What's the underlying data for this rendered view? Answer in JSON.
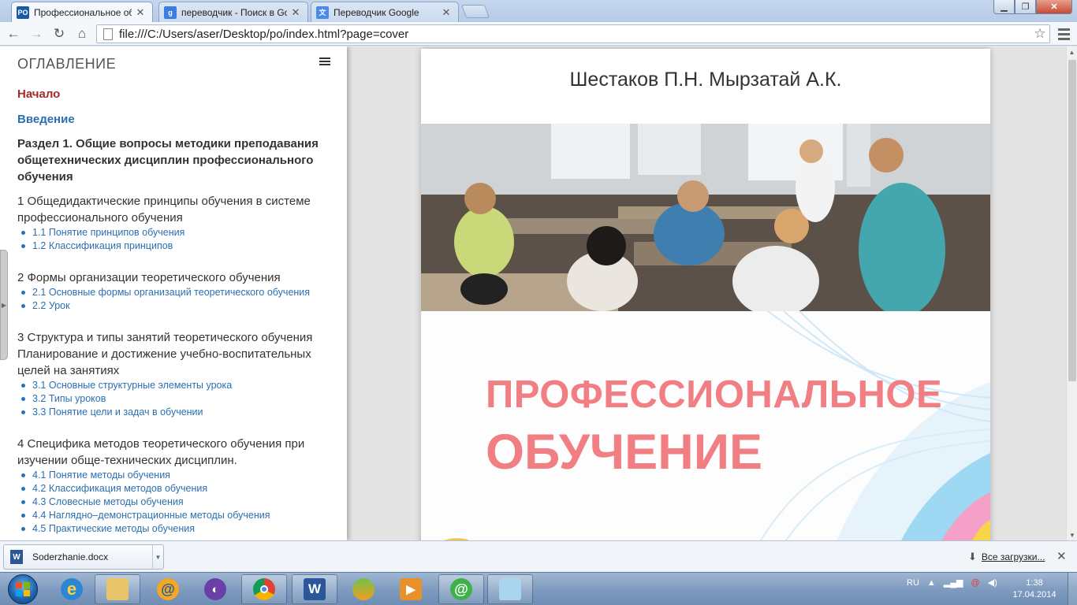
{
  "tabs": [
    {
      "title": "Профессиональное обуч",
      "favicon": "PO",
      "favicon_color": "#1a5aa6",
      "active": true
    },
    {
      "title": "переводчик - Поиск в Goo",
      "favicon": "g",
      "favicon_color": "#3b7de0",
      "active": false
    },
    {
      "title": "Переводчик Google",
      "favicon": "文",
      "favicon_color": "#4a8ae8",
      "active": false
    }
  ],
  "toolbar": {
    "url": "file:///C:/Users/aser/Desktop/po/index.html?page=cover",
    "back_icon": "arrow-left-icon",
    "forward_icon": "arrow-right-icon",
    "reload_icon": "reload-icon",
    "home_icon": "home-icon",
    "bookmark_icon": "star-icon",
    "menu_icon": "menu-icon"
  },
  "sidebar": {
    "title": "ОГЛАВЛЕНИЕ",
    "start": "Начало",
    "intro": "Введение",
    "section": "Раздел 1. Общие вопросы методики преподавания общетехнических дисциплин профессионального обучения",
    "chapters": [
      {
        "title": "1 Общедидактические принципы обучения в системе профессионального обучения",
        "items": [
          "1.1 Понятие принципов обучения",
          "1.2 Классификация принципов"
        ]
      },
      {
        "title": "2 Формы организации теоретического обучения",
        "items": [
          "2.1 Основные формы организаций теоретического обучения",
          "2.2 Урок"
        ]
      },
      {
        "title": "3 Структура и типы занятий теоретического обучения Планирование и достижение учебно-воспитательных целей на занятиях",
        "items": [
          "3.1 Основные структурные элементы урока",
          "3.2 Типы уроков",
          "3.3 Понятие цели и задач в обучении"
        ]
      },
      {
        "title": "4 Специфика методов теоретического обучения при изучении обще-технических дисциплин.",
        "items": [
          "4.1 Понятие методы обучения",
          "4.2 Классификация методов обучения",
          "4.3 Словесные методы обучения",
          "4.4 Наглядно–демонстрационные методы обучения",
          "4.5 Практические методы обучения"
        ]
      }
    ]
  },
  "cover": {
    "authors": "Шестаков П.Н. Мырзатай А.К.",
    "title_line1": "ПРОФЕССИОНАЛЬНОЕ",
    "title_line2": "ОБУЧЕНИЕ",
    "title_color": "#f07e82"
  },
  "downloads": {
    "file_name": "Soderzhanie.docx",
    "all_label": "Все загрузки..."
  },
  "taskbar": {
    "language": "RU",
    "time": "1:38",
    "date": "17.04.2014",
    "apps": [
      "internet-explorer-icon",
      "file-explorer-icon",
      "mail-agent-icon",
      "saturn-icon",
      "chrome-icon",
      "word-icon",
      "calculator-icon",
      "media-player-icon",
      "icq-agent-icon",
      "notepad-icon"
    ]
  }
}
